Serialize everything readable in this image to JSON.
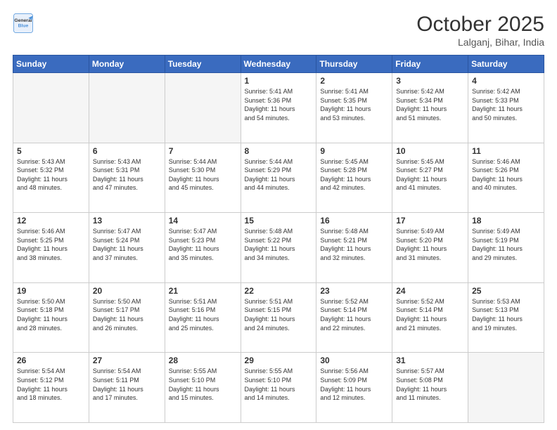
{
  "header": {
    "logo_line1": "General",
    "logo_line2": "Blue",
    "month": "October 2025",
    "location": "Lalganj, Bihar, India"
  },
  "weekdays": [
    "Sunday",
    "Monday",
    "Tuesday",
    "Wednesday",
    "Thursday",
    "Friday",
    "Saturday"
  ],
  "weeks": [
    [
      {
        "day": "",
        "info": ""
      },
      {
        "day": "",
        "info": ""
      },
      {
        "day": "",
        "info": ""
      },
      {
        "day": "1",
        "info": "Sunrise: 5:41 AM\nSunset: 5:36 PM\nDaylight: 11 hours\nand 54 minutes."
      },
      {
        "day": "2",
        "info": "Sunrise: 5:41 AM\nSunset: 5:35 PM\nDaylight: 11 hours\nand 53 minutes."
      },
      {
        "day": "3",
        "info": "Sunrise: 5:42 AM\nSunset: 5:34 PM\nDaylight: 11 hours\nand 51 minutes."
      },
      {
        "day": "4",
        "info": "Sunrise: 5:42 AM\nSunset: 5:33 PM\nDaylight: 11 hours\nand 50 minutes."
      }
    ],
    [
      {
        "day": "5",
        "info": "Sunrise: 5:43 AM\nSunset: 5:32 PM\nDaylight: 11 hours\nand 48 minutes."
      },
      {
        "day": "6",
        "info": "Sunrise: 5:43 AM\nSunset: 5:31 PM\nDaylight: 11 hours\nand 47 minutes."
      },
      {
        "day": "7",
        "info": "Sunrise: 5:44 AM\nSunset: 5:30 PM\nDaylight: 11 hours\nand 45 minutes."
      },
      {
        "day": "8",
        "info": "Sunrise: 5:44 AM\nSunset: 5:29 PM\nDaylight: 11 hours\nand 44 minutes."
      },
      {
        "day": "9",
        "info": "Sunrise: 5:45 AM\nSunset: 5:28 PM\nDaylight: 11 hours\nand 42 minutes."
      },
      {
        "day": "10",
        "info": "Sunrise: 5:45 AM\nSunset: 5:27 PM\nDaylight: 11 hours\nand 41 minutes."
      },
      {
        "day": "11",
        "info": "Sunrise: 5:46 AM\nSunset: 5:26 PM\nDaylight: 11 hours\nand 40 minutes."
      }
    ],
    [
      {
        "day": "12",
        "info": "Sunrise: 5:46 AM\nSunset: 5:25 PM\nDaylight: 11 hours\nand 38 minutes."
      },
      {
        "day": "13",
        "info": "Sunrise: 5:47 AM\nSunset: 5:24 PM\nDaylight: 11 hours\nand 37 minutes."
      },
      {
        "day": "14",
        "info": "Sunrise: 5:47 AM\nSunset: 5:23 PM\nDaylight: 11 hours\nand 35 minutes."
      },
      {
        "day": "15",
        "info": "Sunrise: 5:48 AM\nSunset: 5:22 PM\nDaylight: 11 hours\nand 34 minutes."
      },
      {
        "day": "16",
        "info": "Sunrise: 5:48 AM\nSunset: 5:21 PM\nDaylight: 11 hours\nand 32 minutes."
      },
      {
        "day": "17",
        "info": "Sunrise: 5:49 AM\nSunset: 5:20 PM\nDaylight: 11 hours\nand 31 minutes."
      },
      {
        "day": "18",
        "info": "Sunrise: 5:49 AM\nSunset: 5:19 PM\nDaylight: 11 hours\nand 29 minutes."
      }
    ],
    [
      {
        "day": "19",
        "info": "Sunrise: 5:50 AM\nSunset: 5:18 PM\nDaylight: 11 hours\nand 28 minutes."
      },
      {
        "day": "20",
        "info": "Sunrise: 5:50 AM\nSunset: 5:17 PM\nDaylight: 11 hours\nand 26 minutes."
      },
      {
        "day": "21",
        "info": "Sunrise: 5:51 AM\nSunset: 5:16 PM\nDaylight: 11 hours\nand 25 minutes."
      },
      {
        "day": "22",
        "info": "Sunrise: 5:51 AM\nSunset: 5:15 PM\nDaylight: 11 hours\nand 24 minutes."
      },
      {
        "day": "23",
        "info": "Sunrise: 5:52 AM\nSunset: 5:14 PM\nDaylight: 11 hours\nand 22 minutes."
      },
      {
        "day": "24",
        "info": "Sunrise: 5:52 AM\nSunset: 5:14 PM\nDaylight: 11 hours\nand 21 minutes."
      },
      {
        "day": "25",
        "info": "Sunrise: 5:53 AM\nSunset: 5:13 PM\nDaylight: 11 hours\nand 19 minutes."
      }
    ],
    [
      {
        "day": "26",
        "info": "Sunrise: 5:54 AM\nSunset: 5:12 PM\nDaylight: 11 hours\nand 18 minutes."
      },
      {
        "day": "27",
        "info": "Sunrise: 5:54 AM\nSunset: 5:11 PM\nDaylight: 11 hours\nand 17 minutes."
      },
      {
        "day": "28",
        "info": "Sunrise: 5:55 AM\nSunset: 5:10 PM\nDaylight: 11 hours\nand 15 minutes."
      },
      {
        "day": "29",
        "info": "Sunrise: 5:55 AM\nSunset: 5:10 PM\nDaylight: 11 hours\nand 14 minutes."
      },
      {
        "day": "30",
        "info": "Sunrise: 5:56 AM\nSunset: 5:09 PM\nDaylight: 11 hours\nand 12 minutes."
      },
      {
        "day": "31",
        "info": "Sunrise: 5:57 AM\nSunset: 5:08 PM\nDaylight: 11 hours\nand 11 minutes."
      },
      {
        "day": "",
        "info": ""
      }
    ]
  ]
}
